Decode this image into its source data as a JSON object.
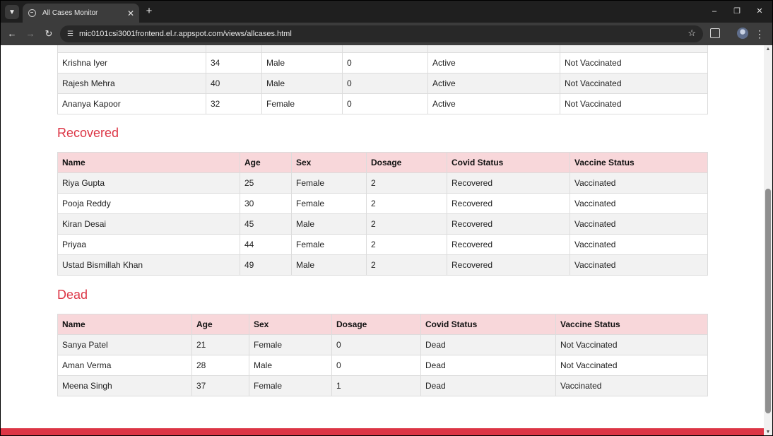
{
  "browser": {
    "tab_title": "All Cases Monitor",
    "url": "mic0101csi3001frontend.el.r.appspot.com/views/allcases.html"
  },
  "active_partial": {
    "rows": [
      [
        "Krishna Iyer",
        "34",
        "Male",
        "0",
        "Active",
        "Not Vaccinated"
      ],
      [
        "Rajesh Mehra",
        "40",
        "Male",
        "0",
        "Active",
        "Not Vaccinated"
      ],
      [
        "Ananya Kapoor",
        "32",
        "Female",
        "0",
        "Active",
        "Not Vaccinated"
      ]
    ]
  },
  "recovered": {
    "title": "Recovered",
    "headers": [
      "Name",
      "Age",
      "Sex",
      "Dosage",
      "Covid Status",
      "Vaccine Status"
    ],
    "rows": [
      [
        "Riya Gupta",
        "25",
        "Female",
        "2",
        "Recovered",
        "Vaccinated"
      ],
      [
        "Pooja Reddy",
        "30",
        "Female",
        "2",
        "Recovered",
        "Vaccinated"
      ],
      [
        "Kiran Desai",
        "45",
        "Male",
        "2",
        "Recovered",
        "Vaccinated"
      ],
      [
        "Priyaa",
        "44",
        "Female",
        "2",
        "Recovered",
        "Vaccinated"
      ],
      [
        "Ustad Bismillah Khan",
        "49",
        "Male",
        "2",
        "Recovered",
        "Vaccinated"
      ]
    ]
  },
  "dead": {
    "title": "Dead",
    "headers": [
      "Name",
      "Age",
      "Sex",
      "Dosage",
      "Covid Status",
      "Vaccine Status"
    ],
    "rows": [
      [
        "Sanya Patel",
        "21",
        "Female",
        "0",
        "Dead",
        "Not Vaccinated"
      ],
      [
        "Aman Verma",
        "28",
        "Male",
        "0",
        "Dead",
        "Not Vaccinated"
      ],
      [
        "Meena Singh",
        "37",
        "Female",
        "1",
        "Dead",
        "Vaccinated"
      ]
    ]
  },
  "colors": {
    "accent": "#dc3545",
    "header_bg": "#f8d7da"
  }
}
